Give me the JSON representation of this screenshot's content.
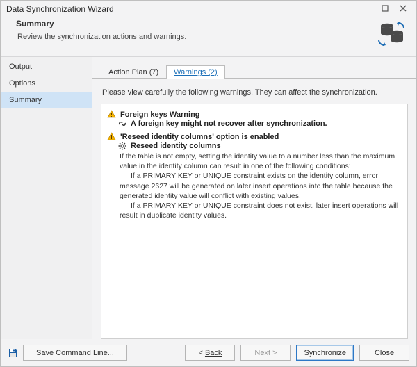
{
  "window": {
    "title": "Data Synchronization Wizard",
    "maximize_icon": "maximize-icon",
    "close_icon": "close-icon"
  },
  "header": {
    "title": "Summary",
    "subtitle": "Review the synchronization actions and warnings."
  },
  "sidebar": {
    "items": [
      {
        "label": "Output",
        "selected": false
      },
      {
        "label": "Options",
        "selected": false
      },
      {
        "label": "Summary",
        "selected": true
      }
    ]
  },
  "tabs": [
    {
      "label": "Action Plan (7)",
      "active": false
    },
    {
      "label": "Warnings (2)",
      "active": true
    }
  ],
  "intro": "Please view carefully the following warnings. They can affect the synchronization.",
  "warnings": [
    {
      "title": "Foreign keys Warning",
      "sub_icon": "link-icon",
      "subtitle": "A foreign key might not recover after synchronization.",
      "desc": []
    },
    {
      "title": "'Reseed identity columns' option is enabled",
      "sub_icon": "gear-icon",
      "subtitle": "Reseed identity columns",
      "desc": [
        "If the table is not empty, setting the identity value to a number less than the maximum value in the identity column can result in one of the following conditions:",
        "If a PRIMARY KEY or UNIQUE constraint exists on the identity column, error message 2627 will be generated on later insert operations into the table because the generated identity value will conflict with existing values.",
        "If a PRIMARY KEY or UNIQUE constraint does not exist, later insert operations will result in duplicate identity values."
      ]
    }
  ],
  "footer": {
    "save": "Save Command Line...",
    "back": "Back",
    "next": "Next >",
    "sync": "Synchronize",
    "close": "Close"
  }
}
